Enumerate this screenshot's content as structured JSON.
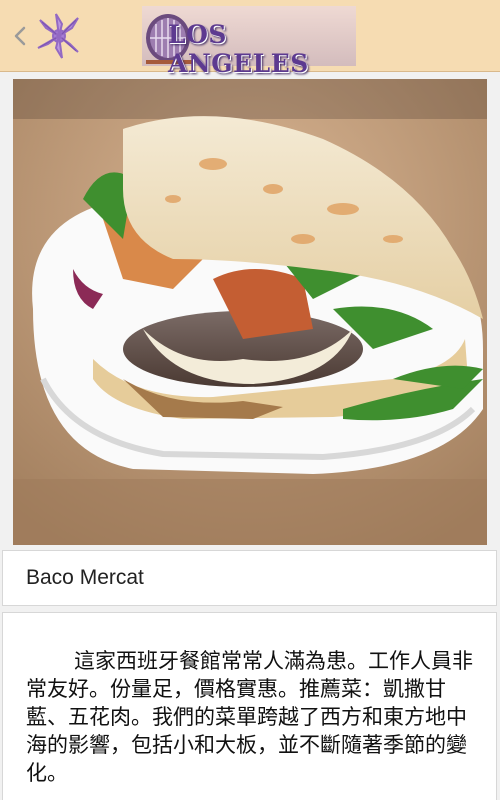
{
  "header": {
    "back_icon": "chevron-left-icon",
    "app_icon": "palm-leaf-icon",
    "logo_text": "LOS ANGELES",
    "colors": {
      "bar": "#f6dcb2",
      "logo": "#6a4a9a"
    }
  },
  "place": {
    "photo": "burger-flatbread-photo",
    "name": "Baco Mercat",
    "description": "這家西班牙餐館常常人滿為患。工作人員非常友好。份量足，價格實惠。推薦菜：凱撒甘藍、五花肉。我們的菜單跨越了西方和東方地中海的影響，包括小和大板，並不斷隨著季節的變化。"
  }
}
